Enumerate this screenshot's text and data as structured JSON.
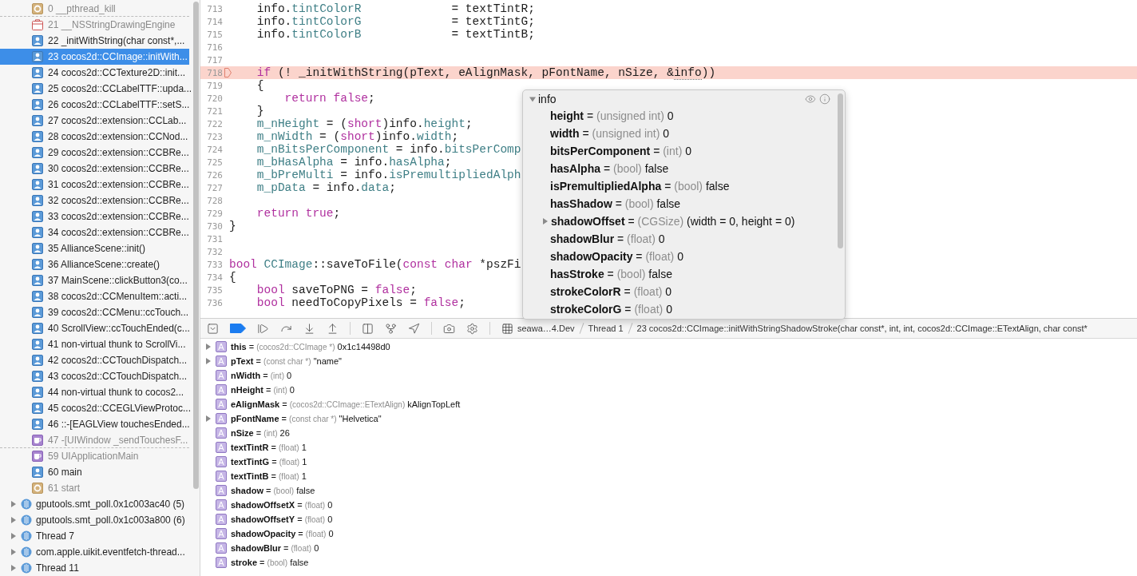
{
  "sidebar": {
    "frames": [
      {
        "label": "0 __pthread_kill",
        "kind": "gear",
        "dimmed": true,
        "selected": false,
        "elided_after": true
      },
      {
        "label": "21 __NSStringDrawingEngine",
        "kind": "toolbox",
        "dimmed": true,
        "selected": false,
        "elided_after": false
      },
      {
        "label": "22 _initWithString(char const*,...",
        "kind": "user",
        "dimmed": false,
        "selected": false,
        "elided_after": false
      },
      {
        "label": "23 cocos2d::CCImage::initWith...",
        "kind": "user",
        "dimmed": false,
        "selected": true,
        "elided_after": false
      },
      {
        "label": "24 cocos2d::CCTexture2D::init...",
        "kind": "user",
        "dimmed": false,
        "selected": false,
        "elided_after": false
      },
      {
        "label": "25 cocos2d::CCLabelTTF::upda...",
        "kind": "user",
        "dimmed": false,
        "selected": false,
        "elided_after": false
      },
      {
        "label": "26 cocos2d::CCLabelTTF::setS...",
        "kind": "user",
        "dimmed": false,
        "selected": false,
        "elided_after": false
      },
      {
        "label": "27 cocos2d::extension::CCLab...",
        "kind": "user",
        "dimmed": false,
        "selected": false,
        "elided_after": false
      },
      {
        "label": "28 cocos2d::extension::CCNod...",
        "kind": "user",
        "dimmed": false,
        "selected": false,
        "elided_after": false
      },
      {
        "label": "29 cocos2d::extension::CCBRe...",
        "kind": "user",
        "dimmed": false,
        "selected": false,
        "elided_after": false
      },
      {
        "label": "30 cocos2d::extension::CCBRe...",
        "kind": "user",
        "dimmed": false,
        "selected": false,
        "elided_after": false
      },
      {
        "label": "31 cocos2d::extension::CCBRe...",
        "kind": "user",
        "dimmed": false,
        "selected": false,
        "elided_after": false
      },
      {
        "label": "32 cocos2d::extension::CCBRe...",
        "kind": "user",
        "dimmed": false,
        "selected": false,
        "elided_after": false
      },
      {
        "label": "33 cocos2d::extension::CCBRe...",
        "kind": "user",
        "dimmed": false,
        "selected": false,
        "elided_after": false
      },
      {
        "label": "34 cocos2d::extension::CCBRe...",
        "kind": "user",
        "dimmed": false,
        "selected": false,
        "elided_after": false
      },
      {
        "label": "35 AllianceScene::init()",
        "kind": "user",
        "dimmed": false,
        "selected": false,
        "elided_after": false
      },
      {
        "label": "36 AllianceScene::create()",
        "kind": "user",
        "dimmed": false,
        "selected": false,
        "elided_after": false
      },
      {
        "label": "37 MainScene::clickButton3(co...",
        "kind": "user",
        "dimmed": false,
        "selected": false,
        "elided_after": false
      },
      {
        "label": "38 cocos2d::CCMenuItem::acti...",
        "kind": "user",
        "dimmed": false,
        "selected": false,
        "elided_after": false
      },
      {
        "label": "39 cocos2d::CCMenu::ccTouch...",
        "kind": "user",
        "dimmed": false,
        "selected": false,
        "elided_after": false
      },
      {
        "label": "40 ScrollView::ccTouchEnded(c...",
        "kind": "user",
        "dimmed": false,
        "selected": false,
        "elided_after": false
      },
      {
        "label": "41 non-virtual thunk to ScrollVi...",
        "kind": "user",
        "dimmed": false,
        "selected": false,
        "elided_after": false
      },
      {
        "label": "42 cocos2d::CCTouchDispatch...",
        "kind": "user",
        "dimmed": false,
        "selected": false,
        "elided_after": false
      },
      {
        "label": "43 cocos2d::CCTouchDispatch...",
        "kind": "user",
        "dimmed": false,
        "selected": false,
        "elided_after": false
      },
      {
        "label": "44 non-virtual thunk to cocos2...",
        "kind": "user",
        "dimmed": false,
        "selected": false,
        "elided_after": false
      },
      {
        "label": "45 cocos2d::CCEGLViewProtoc...",
        "kind": "user",
        "dimmed": false,
        "selected": false,
        "elided_after": false
      },
      {
        "label": "46 ::-[EAGLView touchesEnded...",
        "kind": "user",
        "dimmed": false,
        "selected": false,
        "elided_after": false
      },
      {
        "label": "47 -[UIWindow _sendTouchesF...",
        "kind": "cup",
        "dimmed": true,
        "selected": false,
        "elided_after": true
      },
      {
        "label": "59 UIApplicationMain",
        "kind": "cup",
        "dimmed": true,
        "selected": false,
        "elided_after": false
      },
      {
        "label": "60 main",
        "kind": "user",
        "dimmed": false,
        "selected": false,
        "elided_after": false
      },
      {
        "label": "61 start",
        "kind": "gear",
        "dimmed": true,
        "selected": false,
        "elided_after": false
      }
    ],
    "threads": [
      {
        "label": "gputools.smt_poll.0x1c003ac40 (5)",
        "expanded": false
      },
      {
        "label": "gputools.smt_poll.0x1c003a800 (6)",
        "expanded": false
      },
      {
        "label": "Thread 7",
        "expanded": false
      },
      {
        "label": "com.apple.uikit.eventfetch-thread...",
        "expanded": false
      },
      {
        "label": "Thread 11",
        "expanded": false
      }
    ]
  },
  "editor": {
    "lines": [
      {
        "number": "713",
        "current": false,
        "tokens": [
          {
            "text": "    info.",
            "kind": "plain"
          },
          {
            "text": "tintColorR",
            "kind": "member"
          },
          {
            "text": "             = textTintR;",
            "kind": "plain"
          }
        ]
      },
      {
        "number": "714",
        "current": false,
        "tokens": [
          {
            "text": "    info.",
            "kind": "plain"
          },
          {
            "text": "tintColorG",
            "kind": "member"
          },
          {
            "text": "             = textTintG;",
            "kind": "plain"
          }
        ]
      },
      {
        "number": "715",
        "current": false,
        "tokens": [
          {
            "text": "    info.",
            "kind": "plain"
          },
          {
            "text": "tintColorB",
            "kind": "member"
          },
          {
            "text": "             = textTintB;",
            "kind": "plain"
          }
        ]
      },
      {
        "number": "716",
        "current": false
      },
      {
        "number": "717",
        "current": false
      },
      {
        "number": "718",
        "current": true,
        "tokens": [
          {
            "text": "    if",
            "kind": "keyword"
          },
          {
            "text": " (! _initWithString(pText, eAlignMask, pFontName, nSize, &",
            "kind": "plain"
          },
          {
            "text": "info",
            "kind": "hovered"
          },
          {
            "text": "))",
            "kind": "plain"
          }
        ]
      },
      {
        "number": "719",
        "current": false,
        "tokens": [
          {
            "text": "    {",
            "kind": "plain"
          }
        ]
      },
      {
        "number": "720",
        "current": false,
        "tokens": [
          {
            "text": "        return",
            "kind": "keyword"
          },
          {
            "text": " false",
            "kind": "keyword"
          },
          {
            "text": ";",
            "kind": "plain"
          }
        ]
      },
      {
        "number": "721",
        "current": false,
        "tokens": [
          {
            "text": "    }",
            "kind": "plain"
          }
        ]
      },
      {
        "number": "722",
        "current": false,
        "tokens": [
          {
            "text": "    m_nHeight",
            "kind": "member"
          },
          {
            "text": " = (",
            "kind": "plain"
          },
          {
            "text": "short",
            "kind": "keyword"
          },
          {
            "text": ")info.",
            "kind": "plain"
          },
          {
            "text": "height",
            "kind": "member"
          },
          {
            "text": ";",
            "kind": "plain"
          }
        ]
      },
      {
        "number": "723",
        "current": false,
        "tokens": [
          {
            "text": "    m_nWidth",
            "kind": "member"
          },
          {
            "text": " = (",
            "kind": "plain"
          },
          {
            "text": "short",
            "kind": "keyword"
          },
          {
            "text": ")info.",
            "kind": "plain"
          },
          {
            "text": "width",
            "kind": "member"
          },
          {
            "text": ";",
            "kind": "plain"
          }
        ]
      },
      {
        "number": "724",
        "current": false,
        "tokens": [
          {
            "text": "    m_nBitsPerComponent",
            "kind": "member"
          },
          {
            "text": " = info.",
            "kind": "plain"
          },
          {
            "text": "bitsPerComp",
            "kind": "member"
          }
        ]
      },
      {
        "number": "725",
        "current": false,
        "tokens": [
          {
            "text": "    m_bHasAlpha",
            "kind": "member"
          },
          {
            "text": " = info.",
            "kind": "plain"
          },
          {
            "text": "hasAlpha",
            "kind": "member"
          },
          {
            "text": ";",
            "kind": "plain"
          }
        ]
      },
      {
        "number": "726",
        "current": false,
        "tokens": [
          {
            "text": "    m_bPreMulti",
            "kind": "member"
          },
          {
            "text": " = info.",
            "kind": "plain"
          },
          {
            "text": "isPremultipliedAlph",
            "kind": "member"
          }
        ]
      },
      {
        "number": "727",
        "current": false,
        "tokens": [
          {
            "text": "    m_pData",
            "kind": "member"
          },
          {
            "text": " = info.",
            "kind": "plain"
          },
          {
            "text": "data",
            "kind": "member"
          },
          {
            "text": ";",
            "kind": "plain"
          }
        ]
      },
      {
        "number": "728",
        "current": false
      },
      {
        "number": "729",
        "current": false,
        "tokens": [
          {
            "text": "    return",
            "kind": "keyword"
          },
          {
            "text": " true",
            "kind": "keyword"
          },
          {
            "text": ";",
            "kind": "plain"
          }
        ]
      },
      {
        "number": "730",
        "current": false,
        "tokens": [
          {
            "text": "}",
            "kind": "plain"
          }
        ]
      },
      {
        "number": "731",
        "current": false
      },
      {
        "number": "732",
        "current": false
      },
      {
        "number": "733",
        "current": false,
        "tokens": [
          {
            "text": "bool",
            "kind": "keyword"
          },
          {
            "text": " CCImage",
            "kind": "member"
          },
          {
            "text": "::saveToFile(",
            "kind": "plain"
          },
          {
            "text": "const",
            "kind": "keyword"
          },
          {
            "text": " char",
            "kind": "keyword"
          },
          {
            "text": " *pszFi",
            "kind": "plain"
          }
        ]
      },
      {
        "number": "734",
        "current": false,
        "tokens": [
          {
            "text": "{",
            "kind": "plain"
          }
        ]
      },
      {
        "number": "735",
        "current": false,
        "tokens": [
          {
            "text": "    bool",
            "kind": "keyword"
          },
          {
            "text": " saveToPNG = ",
            "kind": "plain"
          },
          {
            "text": "false",
            "kind": "keyword"
          },
          {
            "text": ";",
            "kind": "plain"
          }
        ]
      },
      {
        "number": "736",
        "current": false,
        "tokens": [
          {
            "text": "    bool",
            "kind": "keyword"
          },
          {
            "text": " needToCopyPixels = ",
            "kind": "plain"
          },
          {
            "text": "false",
            "kind": "keyword"
          },
          {
            "text": ";",
            "kind": "plain"
          }
        ]
      }
    ]
  },
  "popover": {
    "title": "info",
    "expanded": true,
    "rows": [
      {
        "name": "height",
        "op": "=",
        "type": "(unsigned int)",
        "value": "0",
        "expandable": false
      },
      {
        "name": "width",
        "op": "=",
        "type": "(unsigned int)",
        "value": "0",
        "expandable": false
      },
      {
        "name": "bitsPerComponent",
        "op": "=",
        "type": "(int)",
        "value": "0",
        "expandable": false
      },
      {
        "name": "hasAlpha",
        "op": "=",
        "type": "(bool)",
        "value": "false",
        "expandable": false
      },
      {
        "name": "isPremultipliedAlpha",
        "op": "=",
        "type": "(bool)",
        "value": "false",
        "expandable": false
      },
      {
        "name": "hasShadow",
        "op": "=",
        "type": "(bool)",
        "value": "false",
        "expandable": false
      },
      {
        "name": "shadowOffset",
        "op": "=",
        "type": "(CGSize)",
        "value": "(width = 0, height = 0)",
        "expandable": true
      },
      {
        "name": "shadowBlur",
        "op": "=",
        "type": "(float)",
        "value": "0",
        "expandable": false
      },
      {
        "name": "shadowOpacity",
        "op": "=",
        "type": "(float)",
        "value": "0",
        "expandable": false
      },
      {
        "name": "hasStroke",
        "op": "=",
        "type": "(bool)",
        "value": "false",
        "expandable": false
      },
      {
        "name": "strokeColorR",
        "op": "=",
        "type": "(float)",
        "value": "0",
        "expandable": false
      },
      {
        "name": "strokeColorG",
        "op": "=",
        "type": "(float)",
        "value": "0",
        "expandable": false
      }
    ]
  },
  "debug_bar": {
    "breakpoints_active": true,
    "breadcrumbs": [
      "seawa…4.Dev",
      "Thread 1",
      "23 cocos2d::CCImage::initWithStringShadowStroke(char const*, int, int, cocos2d::CCImage::ETextAlign, char const*"
    ]
  },
  "variables": [
    {
      "badge": "A",
      "name": "this",
      "op": "=",
      "type": "(cocos2d::CCImage *)",
      "value": "0x1c14498d0",
      "expandable": true
    },
    {
      "badge": "A",
      "name": "pText",
      "op": "=",
      "type": "(const char *)",
      "value": "\"name\"",
      "expandable": true
    },
    {
      "badge": "A",
      "name": "nWidth",
      "op": "=",
      "type": "(int)",
      "value": "0",
      "expandable": false
    },
    {
      "badge": "A",
      "name": "nHeight",
      "op": "=",
      "type": "(int)",
      "value": "0",
      "expandable": false
    },
    {
      "badge": "A",
      "name": "eAlignMask",
      "op": "=",
      "type": "(cocos2d::CCImage::ETextAlign)",
      "value": "kAlignTopLeft",
      "expandable": false
    },
    {
      "badge": "A",
      "name": "pFontName",
      "op": "=",
      "type": "(const char *)",
      "value": "\"Helvetica\"",
      "expandable": true
    },
    {
      "badge": "A",
      "name": "nSize",
      "op": "=",
      "type": "(int)",
      "value": "26",
      "expandable": false
    },
    {
      "badge": "A",
      "name": "textTintR",
      "op": "=",
      "type": "(float)",
      "value": "1",
      "expandable": false
    },
    {
      "badge": "A",
      "name": "textTintG",
      "op": "=",
      "type": "(float)",
      "value": "1",
      "expandable": false
    },
    {
      "badge": "A",
      "name": "textTintB",
      "op": "=",
      "type": "(float)",
      "value": "1",
      "expandable": false
    },
    {
      "badge": "A",
      "name": "shadow",
      "op": "=",
      "type": "(bool)",
      "value": "false",
      "expandable": false
    },
    {
      "badge": "A",
      "name": "shadowOffsetX",
      "op": "=",
      "type": "(float)",
      "value": "0",
      "expandable": false
    },
    {
      "badge": "A",
      "name": "shadowOffsetY",
      "op": "=",
      "type": "(float)",
      "value": "0",
      "expandable": false
    },
    {
      "badge": "A",
      "name": "shadowOpacity",
      "op": "=",
      "type": "(float)",
      "value": "0",
      "expandable": false
    },
    {
      "badge": "A",
      "name": "shadowBlur",
      "op": "=",
      "type": "(float)",
      "value": "0",
      "expandable": false
    },
    {
      "badge": "A",
      "name": "stroke",
      "op": "=",
      "type": "(bool)",
      "value": "false",
      "expandable": false
    }
  ]
}
